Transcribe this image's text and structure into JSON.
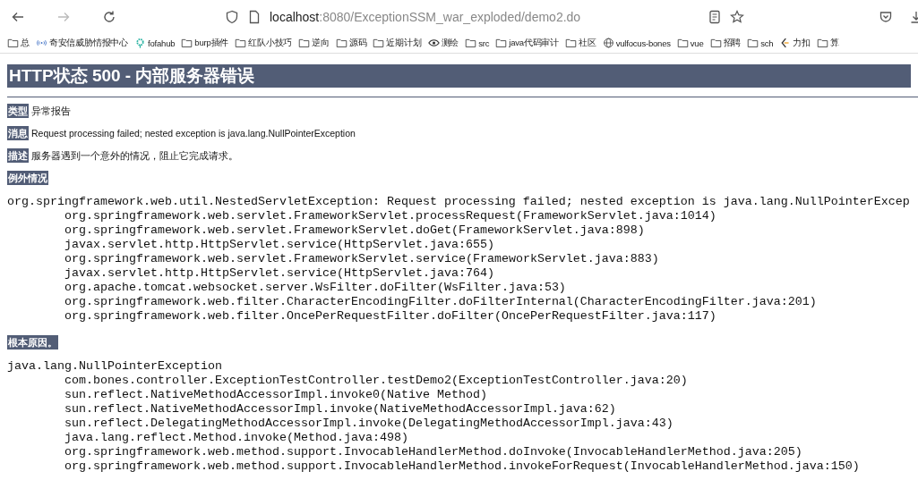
{
  "browser": {
    "url_host": "localhost",
    "url_rest": ":8080/ExceptionSSM_war_exploded/demo2.do",
    "bookmarks": [
      {
        "label": "总",
        "kind": "folder"
      },
      {
        "label": "奇安信威胁情报中心",
        "kind": "site"
      },
      {
        "label": "fofahub",
        "kind": "gear"
      },
      {
        "label": "burp插件",
        "kind": "folder"
      },
      {
        "label": "红队小技巧",
        "kind": "folder"
      },
      {
        "label": "逆向",
        "kind": "folder"
      },
      {
        "label": "源码",
        "kind": "folder"
      },
      {
        "label": "近期计划",
        "kind": "folder"
      },
      {
        "label": "测绘",
        "kind": "eye"
      },
      {
        "label": "src",
        "kind": "folder"
      },
      {
        "label": "java代码审计",
        "kind": "folder"
      },
      {
        "label": "社区",
        "kind": "folder"
      },
      {
        "label": "vulfocus-bones",
        "kind": "globe"
      },
      {
        "label": "vue",
        "kind": "folder"
      },
      {
        "label": "招聘",
        "kind": "folder"
      },
      {
        "label": "sch",
        "kind": "folder"
      },
      {
        "label": "力扣",
        "kind": "leetcode"
      },
      {
        "label": "算",
        "kind": "folder"
      }
    ]
  },
  "page": {
    "title": "HTTP状态 500 - 内部服务器错误",
    "fields": [
      {
        "label": "类型",
        "value": "异常报告"
      },
      {
        "label": "消息",
        "value": "Request processing failed; nested exception is java.lang.NullPointerException"
      },
      {
        "label": "描述",
        "value": "服务器遇到一个意外的情况，阻止它完成请求。"
      }
    ],
    "sections": [
      {
        "heading": "例外情况",
        "lines": [
          {
            "kind": "head",
            "text": "org.springframework.web.util.NestedServletException: Request processing failed; nested exception is java.lang.NullPointerExcep"
          },
          {
            "kind": "frame",
            "text": "org.springframework.web.servlet.FrameworkServlet.processRequest(FrameworkServlet.java:1014)"
          },
          {
            "kind": "frame",
            "text": "org.springframework.web.servlet.FrameworkServlet.doGet(FrameworkServlet.java:898)"
          },
          {
            "kind": "frame",
            "text": "javax.servlet.http.HttpServlet.service(HttpServlet.java:655)"
          },
          {
            "kind": "frame",
            "text": "org.springframework.web.servlet.FrameworkServlet.service(FrameworkServlet.java:883)"
          },
          {
            "kind": "frame",
            "text": "javax.servlet.http.HttpServlet.service(HttpServlet.java:764)"
          },
          {
            "kind": "frame",
            "text": "org.apache.tomcat.websocket.server.WsFilter.doFilter(WsFilter.java:53)"
          },
          {
            "kind": "frame",
            "text": "org.springframework.web.filter.CharacterEncodingFilter.doFilterInternal(CharacterEncodingFilter.java:201)"
          },
          {
            "kind": "frame",
            "text": "org.springframework.web.filter.OncePerRequestFilter.doFilter(OncePerRequestFilter.java:117)"
          }
        ]
      },
      {
        "heading": "根本原因。",
        "lines": [
          {
            "kind": "head",
            "text": "java.lang.NullPointerException"
          },
          {
            "kind": "frame",
            "text": "com.bones.controller.ExceptionTestController.testDemo2(ExceptionTestController.java:20)"
          },
          {
            "kind": "frame",
            "text": "sun.reflect.NativeMethodAccessorImpl.invoke0(Native Method)"
          },
          {
            "kind": "frame",
            "text": "sun.reflect.NativeMethodAccessorImpl.invoke(NativeMethodAccessorImpl.java:62)"
          },
          {
            "kind": "frame",
            "text": "sun.reflect.DelegatingMethodAccessorImpl.invoke(DelegatingMethodAccessorImpl.java:43)"
          },
          {
            "kind": "frame",
            "text": "java.lang.reflect.Method.invoke(Method.java:498)"
          },
          {
            "kind": "frame",
            "text": "org.springframework.web.method.support.InvocableHandlerMethod.doInvoke(InvocableHandlerMethod.java:205)"
          },
          {
            "kind": "frame",
            "text": "org.springframework.web.method.support.InvocableHandlerMethod.invokeForRequest(InvocableHandlerMethod.java:150)"
          }
        ]
      }
    ]
  }
}
